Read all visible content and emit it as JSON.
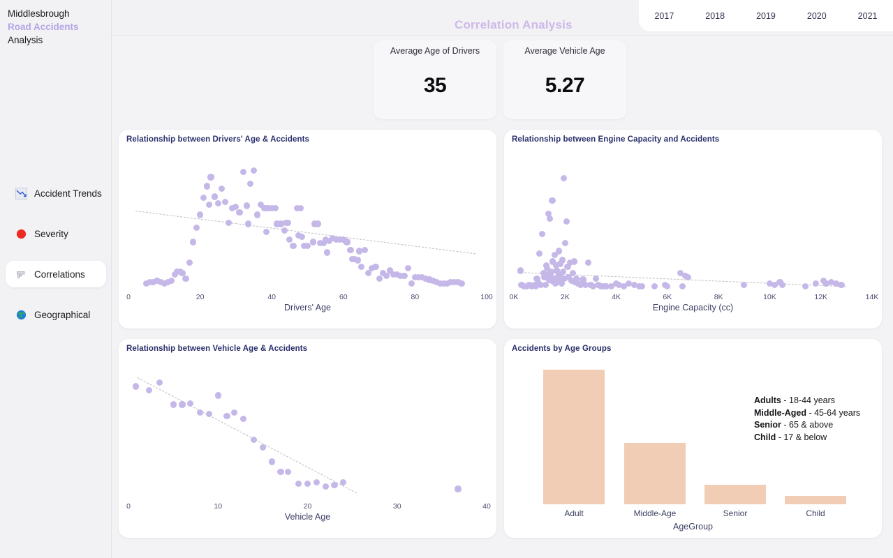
{
  "sidebar": {
    "brand_line1": "Middlesbrough",
    "brand_line2": "Road Accidents",
    "brand_line3": "Analysis",
    "items": [
      {
        "label": "Accident Trends",
        "icon": "chart-decreasing-icon",
        "active": false
      },
      {
        "label": "Severity",
        "icon": "red-circle-icon",
        "active": false
      },
      {
        "label": "Correlations",
        "icon": "pistol-icon",
        "active": true
      },
      {
        "label": "Geographical",
        "icon": "globe-icon",
        "active": false
      }
    ]
  },
  "header": {
    "title": "Correlation Analysis",
    "year_tabs": [
      "2017",
      "2018",
      "2019",
      "2020",
      "2021"
    ]
  },
  "kpis": [
    {
      "label": "Average Age of Drivers",
      "value": "35"
    },
    {
      "label": "Average Vehicle Age",
      "value": "5.27"
    }
  ],
  "colors": {
    "accent_purple": "#cdb9e8",
    "scatter_dot": "#c5b8e8",
    "bar_fill": "#f2cdb6",
    "trendline": "#bdbdc4",
    "title_navy": "#2b2f6b",
    "page_bg": "#f3f3f5"
  },
  "chart_data": [
    {
      "id": "drivers_age",
      "type": "scatter",
      "title": "Relationship between Drivers' Age & Accidents",
      "xlabel": "Drivers' Age",
      "ylabel": "",
      "xticks": [
        0,
        20,
        40,
        60,
        80,
        100
      ],
      "xtick_labels": [
        "0",
        "20",
        "40",
        "60",
        "80",
        "100"
      ],
      "xlim": [
        0,
        100
      ],
      "ylim": [
        0,
        100
      ],
      "grid": false,
      "trendline": {
        "visible": true,
        "style": "dashed",
        "x0": 2,
        "y0": 60,
        "x1": 97,
        "y1": 27
      },
      "points": [
        {
          "x": 5,
          "y": 4
        },
        {
          "x": 6,
          "y": 5
        },
        {
          "x": 7,
          "y": 5
        },
        {
          "x": 8,
          "y": 6
        },
        {
          "x": 9,
          "y": 5
        },
        {
          "x": 10,
          "y": 4
        },
        {
          "x": 11,
          "y": 5
        },
        {
          "x": 12,
          "y": 6
        },
        {
          "x": 13,
          "y": 11
        },
        {
          "x": 13.5,
          "y": 13
        },
        {
          "x": 14.5,
          "y": 13
        },
        {
          "x": 15,
          "y": 12
        },
        {
          "x": 16,
          "y": 8
        },
        {
          "x": 17,
          "y": 20
        },
        {
          "x": 18,
          "y": 36
        },
        {
          "x": 19,
          "y": 47
        },
        {
          "x": 20,
          "y": 57
        },
        {
          "x": 21,
          "y": 70
        },
        {
          "x": 22,
          "y": 79
        },
        {
          "x": 22.5,
          "y": 65
        },
        {
          "x": 23,
          "y": 86
        },
        {
          "x": 24,
          "y": 71
        },
        {
          "x": 25,
          "y": 66
        },
        {
          "x": 26,
          "y": 77
        },
        {
          "x": 27,
          "y": 67
        },
        {
          "x": 28,
          "y": 51
        },
        {
          "x": 29,
          "y": 62
        },
        {
          "x": 30,
          "y": 63
        },
        {
          "x": 31,
          "y": 59
        },
        {
          "x": 32,
          "y": 90
        },
        {
          "x": 33,
          "y": 64
        },
        {
          "x": 33.5,
          "y": 50
        },
        {
          "x": 34,
          "y": 81
        },
        {
          "x": 35,
          "y": 91
        },
        {
          "x": 36,
          "y": 57
        },
        {
          "x": 37,
          "y": 65
        },
        {
          "x": 38,
          "y": 62
        },
        {
          "x": 39,
          "y": 62
        },
        {
          "x": 40,
          "y": 62
        },
        {
          "x": 41,
          "y": 62
        },
        {
          "x": 38.5,
          "y": 44
        },
        {
          "x": 41.5,
          "y": 50
        },
        {
          "x": 42.5,
          "y": 50
        },
        {
          "x": 43.5,
          "y": 45
        },
        {
          "x": 44,
          "y": 51
        },
        {
          "x": 44.5,
          "y": 51
        },
        {
          "x": 45,
          "y": 38
        },
        {
          "x": 46,
          "y": 33
        },
        {
          "x": 47,
          "y": 62
        },
        {
          "x": 48,
          "y": 62
        },
        {
          "x": 47.5,
          "y": 41
        },
        {
          "x": 48.5,
          "y": 40
        },
        {
          "x": 49,
          "y": 33
        },
        {
          "x": 50,
          "y": 33
        },
        {
          "x": 52,
          "y": 50
        },
        {
          "x": 53,
          "y": 50
        },
        {
          "x": 51.5,
          "y": 36
        },
        {
          "x": 53.5,
          "y": 35
        },
        {
          "x": 54.5,
          "y": 35
        },
        {
          "x": 55,
          "y": 38
        },
        {
          "x": 55.5,
          "y": 28
        },
        {
          "x": 56,
          "y": 37
        },
        {
          "x": 57,
          "y": 39
        },
        {
          "x": 58,
          "y": 38
        },
        {
          "x": 59,
          "y": 38
        },
        {
          "x": 60,
          "y": 38
        },
        {
          "x": 60.5,
          "y": 37
        },
        {
          "x": 61,
          "y": 36
        },
        {
          "x": 62,
          "y": 30
        },
        {
          "x": 62.5,
          "y": 23
        },
        {
          "x": 63,
          "y": 23
        },
        {
          "x": 64,
          "y": 22
        },
        {
          "x": 64.5,
          "y": 29
        },
        {
          "x": 65,
          "y": 17
        },
        {
          "x": 66,
          "y": 30
        },
        {
          "x": 67,
          "y": 12
        },
        {
          "x": 68,
          "y": 16
        },
        {
          "x": 69,
          "y": 17
        },
        {
          "x": 70,
          "y": 8
        },
        {
          "x": 71,
          "y": 12
        },
        {
          "x": 72,
          "y": 10
        },
        {
          "x": 73,
          "y": 14
        },
        {
          "x": 74,
          "y": 11
        },
        {
          "x": 75,
          "y": 11
        },
        {
          "x": 76,
          "y": 10
        },
        {
          "x": 77,
          "y": 10
        },
        {
          "x": 78,
          "y": 16
        },
        {
          "x": 79,
          "y": 4
        },
        {
          "x": 80,
          "y": 9
        },
        {
          "x": 81,
          "y": 9
        },
        {
          "x": 82,
          "y": 9
        },
        {
          "x": 83,
          "y": 8
        },
        {
          "x": 84,
          "y": 7
        },
        {
          "x": 85,
          "y": 6
        },
        {
          "x": 86,
          "y": 5
        },
        {
          "x": 87,
          "y": 4
        },
        {
          "x": 88,
          "y": 4
        },
        {
          "x": 89,
          "y": 4
        },
        {
          "x": 90,
          "y": 5
        },
        {
          "x": 91,
          "y": 5
        },
        {
          "x": 92,
          "y": 5
        },
        {
          "x": 93,
          "y": 4
        }
      ]
    },
    {
      "id": "engine_capacity",
      "type": "scatter",
      "title": "Relationship between Engine Capacity and Accidents",
      "xlabel": "Engine Capacity (cc)",
      "ylabel": "",
      "xticks": [
        0,
        2000,
        4000,
        6000,
        8000,
        10000,
        12000,
        14000
      ],
      "xtick_labels": [
        "0K",
        "2K",
        "4K",
        "6K",
        "8K",
        "10K",
        "12K",
        "14K"
      ],
      "xlim": [
        0,
        14000
      ],
      "ylim": [
        0,
        100
      ],
      "grid": false,
      "trendline": {
        "visible": true,
        "style": "dashed",
        "x0": 150,
        "y0": 13,
        "x1": 13000,
        "y1": 2
      },
      "points": [
        {
          "x": 250,
          "y": 14
        },
        {
          "x": 300,
          "y": 3
        },
        {
          "x": 400,
          "y": 2
        },
        {
          "x": 500,
          "y": 2
        },
        {
          "x": 600,
          "y": 3
        },
        {
          "x": 700,
          "y": 2
        },
        {
          "x": 800,
          "y": 3
        },
        {
          "x": 850,
          "y": 2
        },
        {
          "x": 900,
          "y": 8
        },
        {
          "x": 950,
          "y": 5
        },
        {
          "x": 1000,
          "y": 27
        },
        {
          "x": 1050,
          "y": 3
        },
        {
          "x": 1100,
          "y": 42
        },
        {
          "x": 1150,
          "y": 12
        },
        {
          "x": 1200,
          "y": 9
        },
        {
          "x": 1250,
          "y": 3
        },
        {
          "x": 1280,
          "y": 18
        },
        {
          "x": 1300,
          "y": 16
        },
        {
          "x": 1320,
          "y": 11
        },
        {
          "x": 1350,
          "y": 58
        },
        {
          "x": 1380,
          "y": 7
        },
        {
          "x": 1400,
          "y": 54
        },
        {
          "x": 1420,
          "y": 10
        },
        {
          "x": 1450,
          "y": 13
        },
        {
          "x": 1480,
          "y": 6
        },
        {
          "x": 1500,
          "y": 68
        },
        {
          "x": 1520,
          "y": 21
        },
        {
          "x": 1550,
          "y": 8
        },
        {
          "x": 1580,
          "y": 5
        },
        {
          "x": 1600,
          "y": 26
        },
        {
          "x": 1620,
          "y": 4
        },
        {
          "x": 1650,
          "y": 18
        },
        {
          "x": 1680,
          "y": 14
        },
        {
          "x": 1700,
          "y": 9
        },
        {
          "x": 1720,
          "y": 6
        },
        {
          "x": 1750,
          "y": 29
        },
        {
          "x": 1780,
          "y": 5
        },
        {
          "x": 1800,
          "y": 19
        },
        {
          "x": 1820,
          "y": 11
        },
        {
          "x": 1850,
          "y": 7
        },
        {
          "x": 1880,
          "y": 4
        },
        {
          "x": 1900,
          "y": 22
        },
        {
          "x": 1920,
          "y": 13
        },
        {
          "x": 1950,
          "y": 85
        },
        {
          "x": 1980,
          "y": 8
        },
        {
          "x": 2000,
          "y": 35
        },
        {
          "x": 2050,
          "y": 52
        },
        {
          "x": 2100,
          "y": 17
        },
        {
          "x": 2150,
          "y": 9
        },
        {
          "x": 2200,
          "y": 20
        },
        {
          "x": 2250,
          "y": 6
        },
        {
          "x": 2300,
          "y": 12
        },
        {
          "x": 2350,
          "y": 21
        },
        {
          "x": 2400,
          "y": 5
        },
        {
          "x": 2450,
          "y": 8
        },
        {
          "x": 2500,
          "y": 4
        },
        {
          "x": 2600,
          "y": 3
        },
        {
          "x": 2700,
          "y": 7
        },
        {
          "x": 2800,
          "y": 3
        },
        {
          "x": 2900,
          "y": 20
        },
        {
          "x": 3000,
          "y": 3
        },
        {
          "x": 3100,
          "y": 2
        },
        {
          "x": 3200,
          "y": 8
        },
        {
          "x": 3300,
          "y": 3
        },
        {
          "x": 3400,
          "y": 2
        },
        {
          "x": 3500,
          "y": 2
        },
        {
          "x": 3600,
          "y": 2
        },
        {
          "x": 3800,
          "y": 2
        },
        {
          "x": 4000,
          "y": 4
        },
        {
          "x": 4100,
          "y": 3
        },
        {
          "x": 4300,
          "y": 2
        },
        {
          "x": 4500,
          "y": 4
        },
        {
          "x": 4700,
          "y": 3
        },
        {
          "x": 4900,
          "y": 2
        },
        {
          "x": 5000,
          "y": 2
        },
        {
          "x": 5500,
          "y": 2
        },
        {
          "x": 5900,
          "y": 3
        },
        {
          "x": 6000,
          "y": 2
        },
        {
          "x": 6500,
          "y": 12
        },
        {
          "x": 6600,
          "y": 2
        },
        {
          "x": 6700,
          "y": 10
        },
        {
          "x": 6800,
          "y": 9
        },
        {
          "x": 9000,
          "y": 3
        },
        {
          "x": 10000,
          "y": 4
        },
        {
          "x": 10200,
          "y": 3
        },
        {
          "x": 10400,
          "y": 5
        },
        {
          "x": 10500,
          "y": 3
        },
        {
          "x": 11400,
          "y": 2
        },
        {
          "x": 11800,
          "y": 4
        },
        {
          "x": 12100,
          "y": 6
        },
        {
          "x": 12200,
          "y": 4
        },
        {
          "x": 12400,
          "y": 5
        },
        {
          "x": 12600,
          "y": 4
        },
        {
          "x": 12800,
          "y": 3
        }
      ]
    },
    {
      "id": "vehicle_age",
      "type": "scatter",
      "title": "Relationship between Vehicle Age & Accidents",
      "xlabel": "Vehicle Age",
      "ylabel": "",
      "xticks": [
        0,
        10,
        20,
        30,
        40
      ],
      "xtick_labels": [
        "0",
        "10",
        "20",
        "30",
        "40"
      ],
      "xlim": [
        0,
        40
      ],
      "ylim": [
        0,
        100
      ],
      "grid": false,
      "trendline": {
        "visible": true,
        "style": "dashed",
        "x0": 1,
        "y0": 93,
        "x1": 25.5,
        "y1": 4
      },
      "points": [
        {
          "x": 0.8,
          "y": 86
        },
        {
          "x": 2.3,
          "y": 83
        },
        {
          "x": 3.5,
          "y": 89
        },
        {
          "x": 5.0,
          "y": 72
        },
        {
          "x": 6.0,
          "y": 72
        },
        {
          "x": 6.9,
          "y": 73
        },
        {
          "x": 8.0,
          "y": 66
        },
        {
          "x": 9.0,
          "y": 65
        },
        {
          "x": 10.0,
          "y": 79
        },
        {
          "x": 11.0,
          "y": 63
        },
        {
          "x": 11.8,
          "y": 66
        },
        {
          "x": 12.8,
          "y": 61
        },
        {
          "x": 14.0,
          "y": 45
        },
        {
          "x": 15.0,
          "y": 39
        },
        {
          "x": 16.0,
          "y": 28
        },
        {
          "x": 17.0,
          "y": 20
        },
        {
          "x": 17.8,
          "y": 20
        },
        {
          "x": 19.0,
          "y": 11
        },
        {
          "x": 20.0,
          "y": 11
        },
        {
          "x": 21.0,
          "y": 12
        },
        {
          "x": 22.0,
          "y": 9
        },
        {
          "x": 23.0,
          "y": 10
        },
        {
          "x": 24.0,
          "y": 12
        },
        {
          "x": 36.8,
          "y": 7
        }
      ]
    },
    {
      "id": "age_groups",
      "type": "bar",
      "title": "Accidents by Age Groups",
      "xlabel": "AgeGroup",
      "ylabel": "",
      "categories": [
        "Adult",
        "Middle-Age",
        "Senior",
        "Child"
      ],
      "values": [
        192,
        88,
        28,
        12
      ],
      "ylim": [
        0,
        200
      ],
      "grid": false,
      "legend_position": "right",
      "legend": [
        {
          "term": "Adults",
          "desc": " - 18-44 years"
        },
        {
          "term": "Middle-Aged",
          "desc": " - 45-64 years"
        },
        {
          "term": "Senior",
          "desc": " - 65 & above"
        },
        {
          "term": "Child",
          "desc": " - 17 & below"
        }
      ]
    }
  ]
}
